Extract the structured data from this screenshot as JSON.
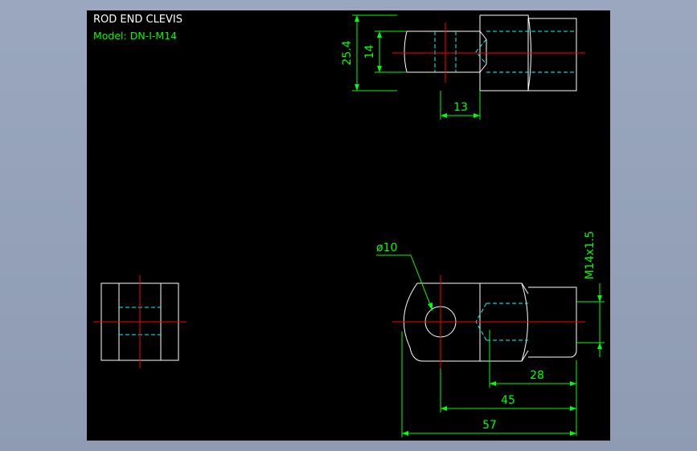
{
  "drawing": {
    "title": "ROD END CLEVIS",
    "model": "Model: DN-I-M14",
    "colors": {
      "background": "#8f9db6",
      "canvas": "#000000",
      "outline": "#ffffff",
      "dimension": "#00ff00",
      "centerline": "#ff0000",
      "hidden": "#00ffff"
    },
    "dimensions": {
      "height_total": "25.4",
      "slot_width": "14",
      "slot_depth": "13",
      "pin_diameter": "ø10",
      "thread": "M14x1.5",
      "thread_length": "28",
      "pin_to_end": "45",
      "overall_length": "57"
    }
  }
}
